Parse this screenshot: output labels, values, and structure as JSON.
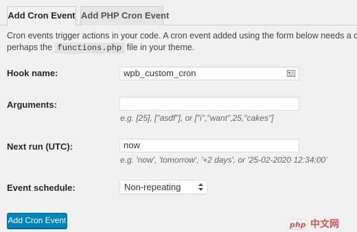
{
  "tabs": [
    {
      "label": "Add Cron Event",
      "active": true
    },
    {
      "label": "Add PHP Cron Event",
      "active": false
    }
  ],
  "description": {
    "line1": "Cron events trigger actions in your code. A cron event added using the form below needs a corresponding action",
    "line2_before": "perhaps the",
    "line2_code": "functions.php",
    "line2_after": "file in your theme."
  },
  "form": {
    "hook_name": {
      "label": "Hook name:",
      "value": "wpb_custom_cron",
      "icon": "contact-card-icon"
    },
    "arguments": {
      "label": "Arguments:",
      "value": "",
      "hint": "e.g. [25], [\"asdf\"], or [\"i\",\"want\",25,\"cakes\"]"
    },
    "next_run": {
      "label": "Next run (UTC):",
      "value": "now",
      "hint": "e.g. 'now', 'tomorrow', '+2 days', or '25-02-2020 12:34:00'"
    },
    "schedule": {
      "label": "Event schedule:",
      "selected": "Non-repeating"
    },
    "submit_label": "Add Cron Event"
  },
  "watermark": {
    "php": "php",
    "text": "中文网"
  },
  "colors": {
    "accent": "#0085ba",
    "background": "#f1f1f1",
    "watermark_red": "#e04a45"
  }
}
